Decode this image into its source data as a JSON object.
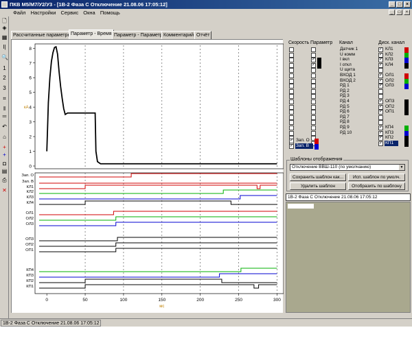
{
  "window": {
    "title": "ПКВ М5/М7/У2/У3 - [1В-2 Фаза С Отключение 21.08.06 17:05:12]",
    "controls": [
      "_",
      "□",
      "×"
    ]
  },
  "menu": {
    "items": [
      "Файл",
      "Настройки",
      "Сервис",
      "Окна",
      "Помощь"
    ]
  },
  "toolbar": {
    "icons": [
      "document-icon",
      "open-icon",
      "save-icon",
      "cursor-icon",
      "zoom-icon",
      "one-icon",
      "two-icon",
      "three-icon",
      "crop-icon",
      "split-vertical-icon",
      "split-horizontal-icon",
      "undo-icon",
      "home-icon",
      "plus-icon",
      "blue-plus-icon",
      "frame-icon",
      "print-preview-icon",
      "print-icon",
      "close-red-icon"
    ],
    "glyphs": [
      "🗋",
      "◈",
      "▦",
      "I|",
      "🔍",
      "1",
      "2",
      "3",
      "⌗",
      "‖",
      "═",
      "↶",
      "⌂",
      "+",
      "+",
      "◘",
      "▤",
      "⎙",
      "✕"
    ]
  },
  "tabs": [
    {
      "label": "Рассчитанные параметры"
    },
    {
      "label": "Параметр - Время",
      "active": true
    },
    {
      "label": "Параметр - Параметр"
    },
    {
      "label": "Комментарий"
    },
    {
      "label": "Отчёт"
    }
  ],
  "chart_data": {
    "type": "line",
    "x_axis": {
      "ticks": [
        0,
        50,
        100,
        150,
        200,
        250,
        300
      ],
      "label": "мс",
      "range": [
        -10,
        305
      ]
    },
    "y_axis": {
      "ticks": [
        0,
        1,
        2,
        3,
        4,
        5,
        6,
        7,
        8
      ],
      "label": "кА",
      "range": [
        0,
        8.2
      ]
    },
    "analog_series": [
      {
        "name": "I откл",
        "color": "#000000",
        "points": [
          [
            0,
            1.0
          ],
          [
            1,
            2.6
          ],
          [
            2,
            4.3
          ],
          [
            4,
            6.0
          ],
          [
            6,
            7.1
          ],
          [
            8,
            7.7
          ],
          [
            10,
            8.05
          ],
          [
            12,
            8.1
          ],
          [
            14,
            7.6
          ],
          [
            16,
            6.4
          ],
          [
            18,
            5.4
          ],
          [
            20,
            4.6
          ],
          [
            22,
            3.9
          ],
          [
            24,
            3.5
          ],
          [
            27,
            3.6
          ],
          [
            30,
            3.6
          ],
          [
            40,
            3.6
          ],
          [
            50,
            3.6
          ],
          [
            63,
            3.6
          ],
          [
            64,
            1.0
          ],
          [
            66,
            0.3
          ],
          [
            70,
            0.15
          ],
          [
            100,
            0.15
          ],
          [
            200,
            0.15
          ],
          [
            300,
            0.15
          ]
        ]
      }
    ],
    "digital_rows": [
      {
        "name": "Зап. О",
        "color": "#d00000",
        "edges": [
          [
            -10,
            0
          ],
          [
            110,
            1
          ],
          [
            300,
            1
          ]
        ]
      },
      {
        "name": "Зап. В",
        "color": "#d00000",
        "edges": [
          [
            -10,
            0
          ],
          [
            300,
            0
          ]
        ]
      },
      {
        "name": "КЛ1",
        "color": "#d00000",
        "edges": [
          [
            -10,
            0
          ],
          [
            50,
            1
          ],
          [
            274,
            0
          ],
          [
            278,
            1
          ],
          [
            300,
            1
          ]
        ]
      },
      {
        "name": "КЛ2",
        "color": "#00b000",
        "edges": [
          [
            -10,
            0
          ],
          [
            230,
            1
          ],
          [
            300,
            1
          ]
        ]
      },
      {
        "name": "КЛ3",
        "color": "#0000d0",
        "edges": [
          [
            -10,
            0
          ],
          [
            252,
            1
          ],
          [
            300,
            1
          ]
        ]
      },
      {
        "name": "КЛ4",
        "color": "#000000",
        "edges": [
          [
            -10,
            0
          ],
          [
            50,
            1
          ],
          [
            240,
            0
          ],
          [
            300,
            0
          ]
        ]
      },
      {
        "name": "ОЛ1",
        "color": "#d00000",
        "edges": [
          [
            -10,
            0
          ],
          [
            87,
            1
          ],
          [
            300,
            1
          ]
        ]
      },
      {
        "name": "ОЛ2",
        "color": "#00b000",
        "edges": [
          [
            -10,
            0
          ],
          [
            90,
            1
          ],
          [
            300,
            1
          ]
        ]
      },
      {
        "name": "ОЛ3",
        "color": "#0000d0",
        "edges": [
          [
            -10,
            0
          ],
          [
            90,
            1
          ],
          [
            300,
            1
          ]
        ]
      },
      {
        "name": "ОП3",
        "color": "#000000",
        "edges": [
          [
            -10,
            0
          ],
          [
            92,
            1
          ],
          [
            300,
            1
          ]
        ]
      },
      {
        "name": "ОП2",
        "color": "#000000",
        "edges": [
          [
            -10,
            0
          ],
          [
            90,
            1
          ],
          [
            300,
            1
          ]
        ]
      },
      {
        "name": "ОП1",
        "color": "#000000",
        "edges": [
          [
            -10,
            0
          ],
          [
            90,
            1
          ],
          [
            300,
            1
          ]
        ]
      },
      {
        "name": "КП4",
        "color": "#00b000",
        "edges": [
          [
            -10,
            0
          ],
          [
            253,
            1
          ],
          [
            300,
            1
          ]
        ]
      },
      {
        "name": "КП3",
        "color": "#0000d0",
        "edges": [
          [
            -10,
            0
          ],
          [
            225,
            1
          ],
          [
            300,
            1
          ]
        ]
      },
      {
        "name": "КП2",
        "color": "#000000",
        "edges": [
          [
            -10,
            0
          ],
          [
            50,
            1
          ],
          [
            228,
            0
          ],
          [
            300,
            0
          ]
        ]
      },
      {
        "name": "КП1",
        "color": "#000000",
        "edges": [
          [
            -10,
            0
          ],
          [
            50,
            1
          ],
          [
            270,
            0
          ],
          [
            276,
            1
          ],
          [
            300,
            1
          ]
        ]
      }
    ],
    "digital_row_spacing_ms_note": "",
    "markers": [
      50,
      100,
      150,
      200,
      250,
      300
    ]
  },
  "panel": {
    "headers": {
      "speed": "Скорость",
      "param": "Параметр",
      "channel": "Канал",
      "discrete": "Диск. канал"
    },
    "channels": [
      "Датчик 1",
      "U комм",
      "I вкл",
      "I откл",
      "U щита",
      "ВХОД 1",
      "ВХОД 2",
      "РД 1",
      "РД 2",
      "РД 3",
      "РД 4",
      "РД 5",
      "РД 6",
      "РД 7",
      "РД 8",
      "РД 9",
      "РД 10"
    ],
    "param_checked": [
      false,
      false,
      true,
      true,
      false,
      false,
      false,
      false,
      false,
      false,
      false,
      false,
      false,
      false,
      false,
      false,
      false
    ],
    "param_colors": [
      "",
      "",
      "#000000",
      "#000000",
      "",
      "",
      "",
      "",
      "",
      "",
      "",
      "",
      "",
      "",
      "",
      "",
      ""
    ],
    "discrete": [
      {
        "label": "КЛ1",
        "checked": true,
        "color": "#d00000"
      },
      {
        "label": "КЛ2",
        "checked": true,
        "color": "#00b000"
      },
      {
        "label": "КЛ3",
        "checked": true,
        "color": "#0000d0"
      },
      {
        "label": "КЛ4",
        "checked": true,
        "color": "#000000"
      },
      {
        "label": "",
        "checked": false,
        "color": ""
      },
      {
        "label": "ОЛ1",
        "checked": true,
        "color": "#d00000"
      },
      {
        "label": "ОЛ2",
        "checked": true,
        "color": "#00b000"
      },
      {
        "label": "ОЛ3",
        "checked": true,
        "color": "#0000d0"
      },
      {
        "label": "",
        "checked": false,
        "color": ""
      },
      {
        "label": "",
        "checked": false,
        "color": ""
      },
      {
        "label": "ОП3",
        "checked": true,
        "color": "#000000"
      },
      {
        "label": "ОП2",
        "checked": true,
        "color": "#000000"
      },
      {
        "label": "ОП1",
        "checked": true,
        "color": "#000000"
      },
      {
        "label": "",
        "checked": false,
        "color": ""
      },
      {
        "label": "",
        "checked": false,
        "color": ""
      },
      {
        "label": "КП4",
        "checked": true,
        "color": "#00b000"
      },
      {
        "label": "КП3",
        "checked": true,
        "color": "#0000d0"
      },
      {
        "label": "КП2",
        "checked": true,
        "color": "#000000"
      },
      {
        "label": "КП1",
        "checked": true,
        "color": "#000000",
        "selected": true
      }
    ],
    "zap": [
      {
        "label": "Зап. О",
        "checked": true,
        "color": "#d00000"
      },
      {
        "label": "Зап. В",
        "checked": true,
        "color": "#0000d0",
        "selected": true
      }
    ]
  },
  "templates": {
    "legend": "Шаблоны отображения",
    "combo_value": "Отключение ВВШ-110 (по умолчанию)",
    "buttons": [
      "Сохранить шаблон как...",
      "Исп. шаблон по умолч.",
      "Удалить шаблон",
      "Отобразить по шаблону"
    ]
  },
  "records": {
    "selected": "1В-2 Фаза С Отключение 21.08.06 17:05:12"
  },
  "status": {
    "text": "1В-2 Фаза С Отключение 21.08.06 17:05:12"
  }
}
